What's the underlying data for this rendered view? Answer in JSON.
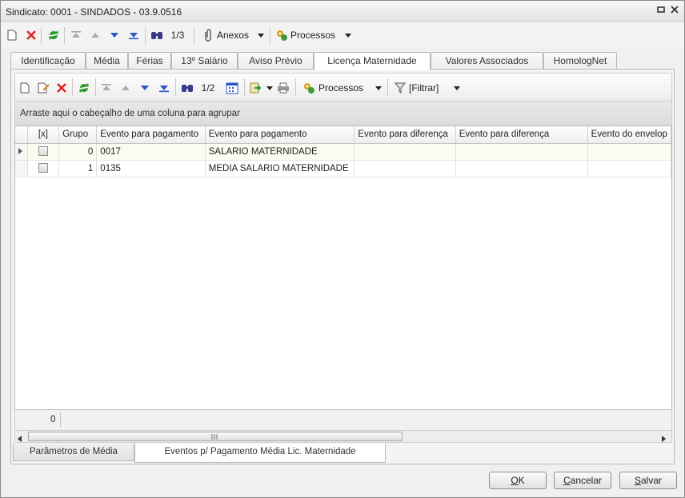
{
  "window": {
    "title": "Sindicato: 0001 - SINDADOS - 03.9.0516"
  },
  "toolbar1": {
    "record_counter": "1/3",
    "anexos_label": "Anexos",
    "processos_label": "Processos"
  },
  "tabs_top": [
    {
      "label": "Identificação"
    },
    {
      "label": "Média"
    },
    {
      "label": "Férias"
    },
    {
      "label": "13º Salário"
    },
    {
      "label": "Aviso Prévio"
    },
    {
      "label": "Licença Maternidade"
    },
    {
      "label": "Valores Associados"
    },
    {
      "label": "HomologNet"
    }
  ],
  "toolbar2": {
    "record_counter": "1/2",
    "processos_label": "Processos",
    "filtrar_label": "[Filtrar]"
  },
  "grid": {
    "group_hint": "Arraste aqui o cabeçalho de uma coluna para agrupar",
    "columns": [
      {
        "label": "[x]"
      },
      {
        "label": "Grupo"
      },
      {
        "label": "Evento para pagamento"
      },
      {
        "label": "Evento para pagamento"
      },
      {
        "label": "Evento para diferença"
      },
      {
        "label": "Evento para diferença"
      },
      {
        "label": "Evento do envelop"
      }
    ],
    "rows": [
      {
        "grupo": "0",
        "evento_codigo": "0017",
        "evento_nome": "SALARIO MATERNIDADE"
      },
      {
        "grupo": "1",
        "evento_codigo": "0135",
        "evento_nome": "MEDIA SALARIO MATERNIDADE"
      }
    ],
    "footer_count": "0"
  },
  "tabs_bottom": [
    {
      "label": "Parâmetros de Média"
    },
    {
      "label": "Eventos p/ Pagamento Média Lic. Maternidade"
    }
  ],
  "buttons": {
    "ok_u": "O",
    "ok_rest": "K",
    "cancel_u": "C",
    "cancel_rest": "ancelar",
    "save_u": "S",
    "save_rest": "alvar"
  }
}
